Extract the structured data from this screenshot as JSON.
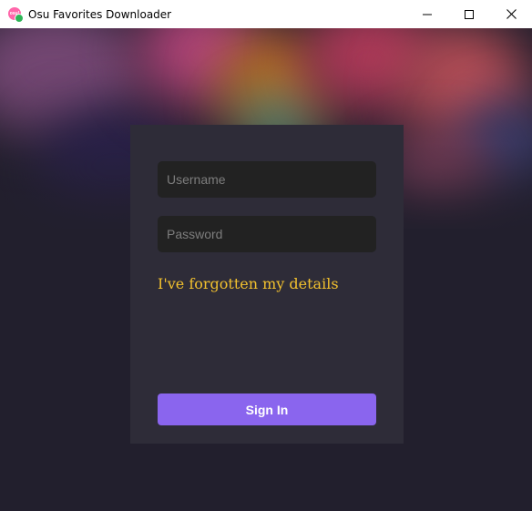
{
  "window": {
    "title": "Osu Favorites Downloader",
    "icon": "osu-app-icon",
    "controls": [
      "minimize-icon",
      "maximize-icon",
      "close-icon"
    ]
  },
  "login": {
    "username_placeholder": "Username",
    "username_value": "",
    "password_placeholder": "Password",
    "password_value": "",
    "forgot_label": "I've forgotten my details",
    "signin_label": "Sign In"
  },
  "colors": {
    "background": "#221f2d",
    "card": "#2e2c38",
    "input": "#222222",
    "forgot_link": "#f2c12e",
    "accent": "#8a65ee"
  }
}
